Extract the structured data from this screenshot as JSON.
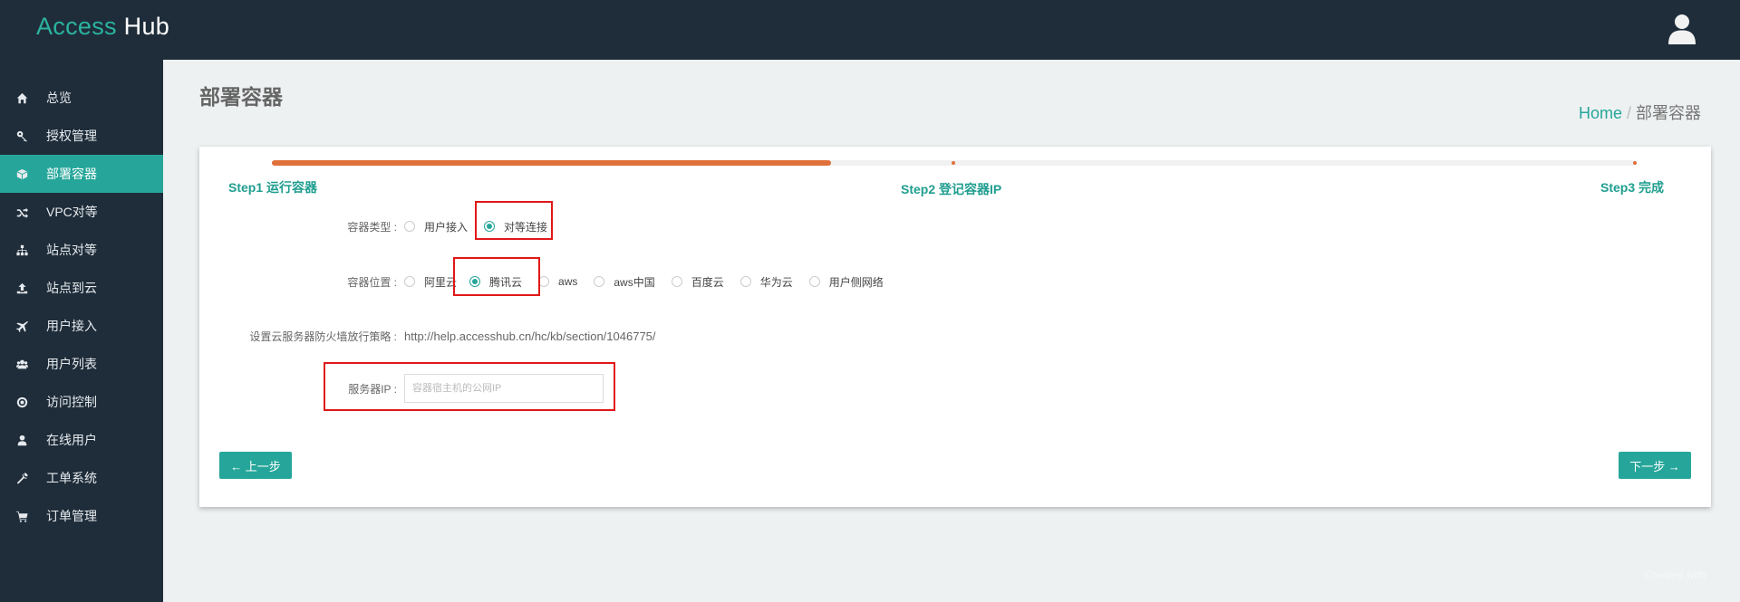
{
  "header": {
    "brand_part1": "Access",
    "brand_part2": "Hub",
    "user_icon": "user-icon"
  },
  "sidebar": {
    "items": [
      {
        "label": "总览",
        "icon": "home-icon"
      },
      {
        "label": "授权管理",
        "icon": "key-icon"
      },
      {
        "label": "部署容器",
        "icon": "cube-icon",
        "active": true
      },
      {
        "label": "VPC对等",
        "icon": "shuffle-icon"
      },
      {
        "label": "站点对等",
        "icon": "sitemap-icon"
      },
      {
        "label": "站点到云",
        "icon": "upload-icon"
      },
      {
        "label": "用户接入",
        "icon": "plane-icon"
      },
      {
        "label": "用户列表",
        "icon": "users-icon"
      },
      {
        "label": "访问控制",
        "icon": "target-icon"
      },
      {
        "label": "在线用户",
        "icon": "user-icon"
      },
      {
        "label": "工单系统",
        "icon": "wrench-icon"
      },
      {
        "label": "订单管理",
        "icon": "cart-icon"
      }
    ]
  },
  "page": {
    "title": "部署容器",
    "breadcrumb_home": "Home",
    "breadcrumb_sep": "/",
    "breadcrumb_current": "部署容器"
  },
  "wizard": {
    "progress_fraction": 0.41,
    "steps": [
      "Step1 运行容器",
      "Step2 登记容器IP",
      "Step3 完成"
    ],
    "container_type": {
      "label": "容器类型 :",
      "options": [
        "用户接入",
        "对等连接"
      ],
      "selected": "对等连接"
    },
    "container_location": {
      "label": "容器位置 :",
      "options": [
        "阿里云",
        "腾讯云",
        "aws",
        "aws中国",
        "百度云",
        "华为云",
        "用户侧网络"
      ],
      "selected": "腾讯云"
    },
    "firewall": {
      "label": "设置云服务器防火墙放行策略 :",
      "url": "http://help.accesshub.cn/hc/kb/section/1046775/"
    },
    "server_ip": {
      "label": "服务器IP :",
      "value": "",
      "placeholder": "容器宿主机的公网IP"
    },
    "prev_button": "← 上一步",
    "next_button": "下一步 →"
  },
  "footer": {
    "note": "Created with"
  },
  "colors": {
    "accent": "#26a69a",
    "progress": "#e0703a",
    "highlight": "#e01818",
    "sidebar_bg": "#1f2d3a"
  }
}
